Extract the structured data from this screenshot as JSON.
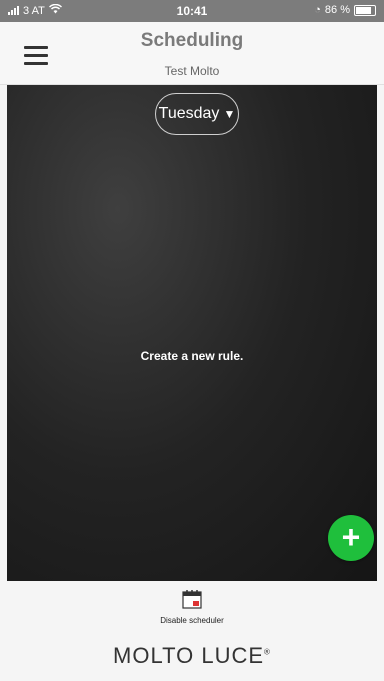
{
  "status_bar": {
    "carrier": "3 AT",
    "time": "10:41",
    "battery": "86 %"
  },
  "header": {
    "title": "Scheduling",
    "subtitle": "Test Molto"
  },
  "main": {
    "day_selector": "Tuesday",
    "empty_message": "Create a new rule.",
    "add_icon": "plus-icon"
  },
  "footer": {
    "disable_label": "Disable scheduler",
    "brand": "MOLTO LUCE",
    "brand_mark": "®"
  },
  "colors": {
    "accent_green": "#1fbf3c",
    "status_bar": "#7c7c7c",
    "title_gray": "#7a7a7a"
  }
}
